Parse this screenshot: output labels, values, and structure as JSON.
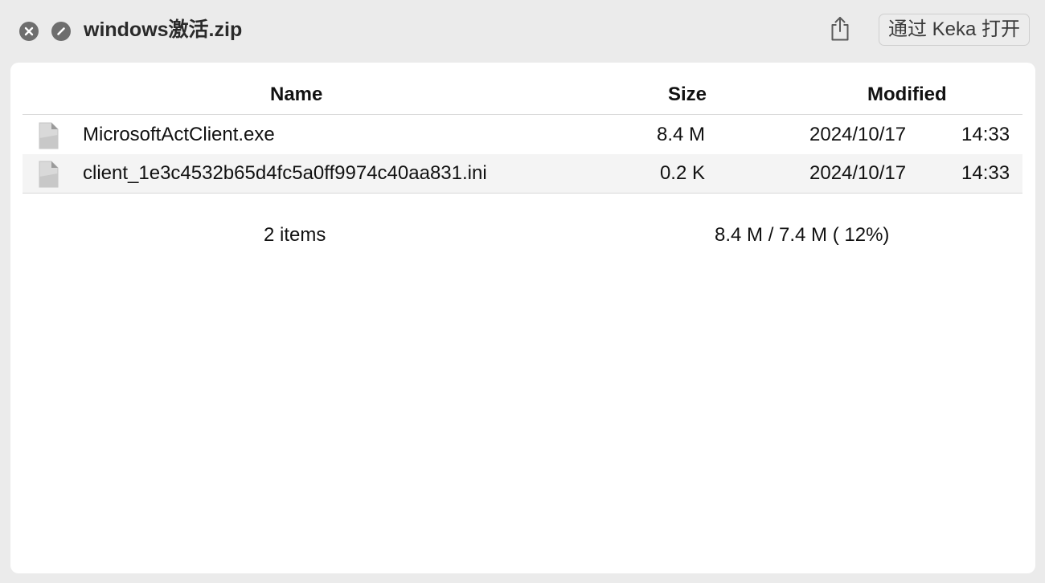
{
  "window": {
    "title": "windows激活.zip",
    "open_button_label": "通过 Keka 打开"
  },
  "icons": {
    "close": "close-icon",
    "stop": "stop-icon",
    "share": "share-icon",
    "file": "document-icon"
  },
  "table": {
    "headers": {
      "name": "Name",
      "size": "Size",
      "modified": "Modified"
    },
    "rows": [
      {
        "name": "MicrosoftActClient.exe",
        "size": "8.4 M",
        "date": "2024/10/17",
        "time": "14:33"
      },
      {
        "name": "client_1e3c4532b65d4fc5a0ff9974c40aa831.ini",
        "size": "0.2 K",
        "date": "2024/10/17",
        "time": "14:33"
      }
    ]
  },
  "footer": {
    "item_count": "2 items",
    "size_ratio": "8.4 M / 7.4 M ( 12%)"
  },
  "colors": {
    "window_background": "#ebebeb",
    "content_background": "#ffffff",
    "alt_row": "#f4f4f4",
    "titlebar_button": "#6e6e6e"
  }
}
